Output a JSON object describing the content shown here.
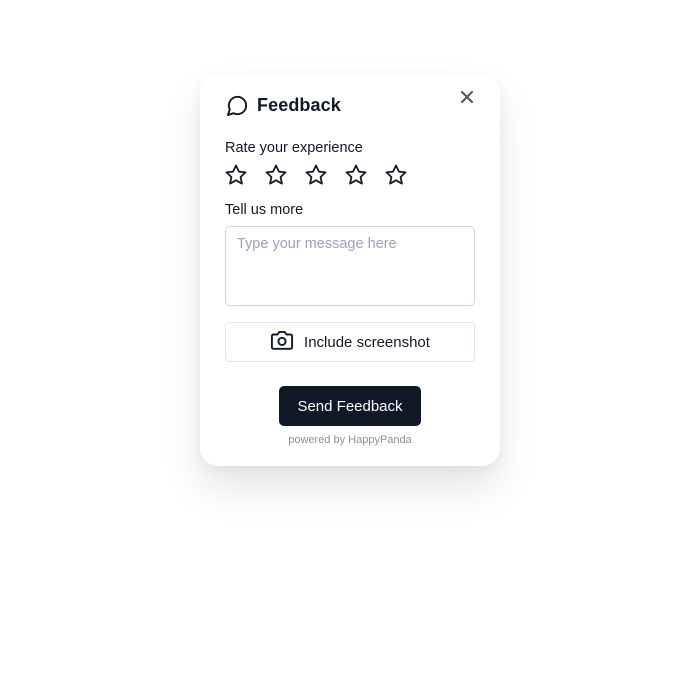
{
  "widget": {
    "title": "Feedback",
    "title_icon": "chat-bubble-icon",
    "close_icon": "close-icon"
  },
  "rating": {
    "label": "Rate your experience",
    "max_stars": 5,
    "selected": 0,
    "star_icon": "star-outline-icon"
  },
  "message": {
    "label": "Tell us more",
    "value": "",
    "placeholder": "Type your message here"
  },
  "screenshot_button": {
    "label": "Include screenshot",
    "icon": "camera-icon"
  },
  "submit_button": {
    "label": "Send Feedback"
  },
  "footer": {
    "powered_by": "powered by HappyPanda"
  },
  "colors": {
    "primary": "#111827",
    "placeholder": "#9ba3b4",
    "border": "#cfd3dd",
    "muted": "#8a90a0"
  }
}
